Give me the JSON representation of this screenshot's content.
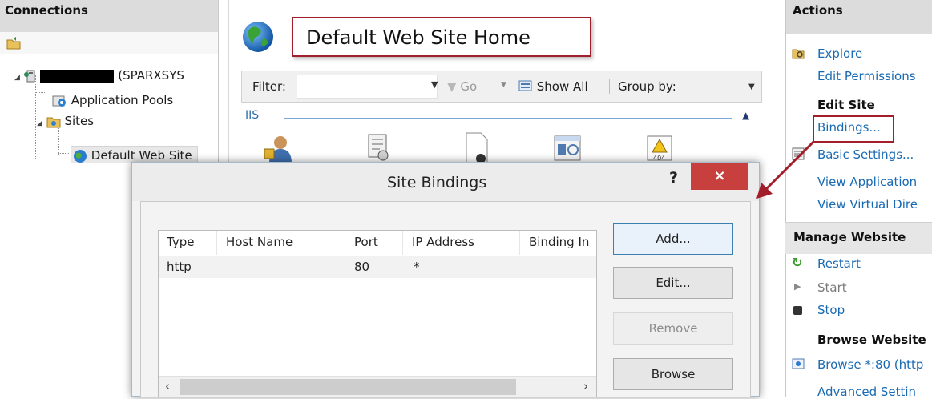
{
  "connections": {
    "header": "Connections",
    "tree": {
      "server_suffix": "(SPARXSYS",
      "app_pools": "Application Pools",
      "sites": "Sites",
      "default_site": "Default Web Site"
    }
  },
  "center": {
    "home_title": "Default Web Site Home",
    "filter_label": "Filter:",
    "go_label": "Go",
    "show_all_label": "Show All",
    "group_by_label": "Group by:",
    "section_label": "IIS"
  },
  "actions": {
    "header": "Actions",
    "explore": "Explore",
    "edit_permissions": "Edit Permissions",
    "edit_site_heading": "Edit Site",
    "bindings": "Bindings...",
    "basic_settings": "Basic Settings...",
    "view_applications": "View Application",
    "view_virtual_dirs": "View Virtual Dire",
    "manage_website_heading": "Manage Website",
    "restart": "Restart",
    "start": "Start",
    "stop": "Stop",
    "browse_website_heading": "Browse Website",
    "browse_80": "Browse *:80 (http",
    "advanced_settings": "Advanced Settin"
  },
  "dialog": {
    "title": "Site Bindings",
    "help_label": "?",
    "close_label": "×",
    "columns": [
      "Type",
      "Host Name",
      "Port",
      "IP Address",
      "Binding In"
    ],
    "rows": [
      {
        "type": "http",
        "host": "",
        "port": "80",
        "ip": "*",
        "binding": ""
      }
    ],
    "buttons": {
      "add": "Add...",
      "edit": "Edit...",
      "remove": "Remove",
      "browse": "Browse"
    }
  },
  "colors": {
    "highlight_red": "#a21e2a",
    "link_blue": "#1a6ab3",
    "close_red": "#c7403d"
  }
}
